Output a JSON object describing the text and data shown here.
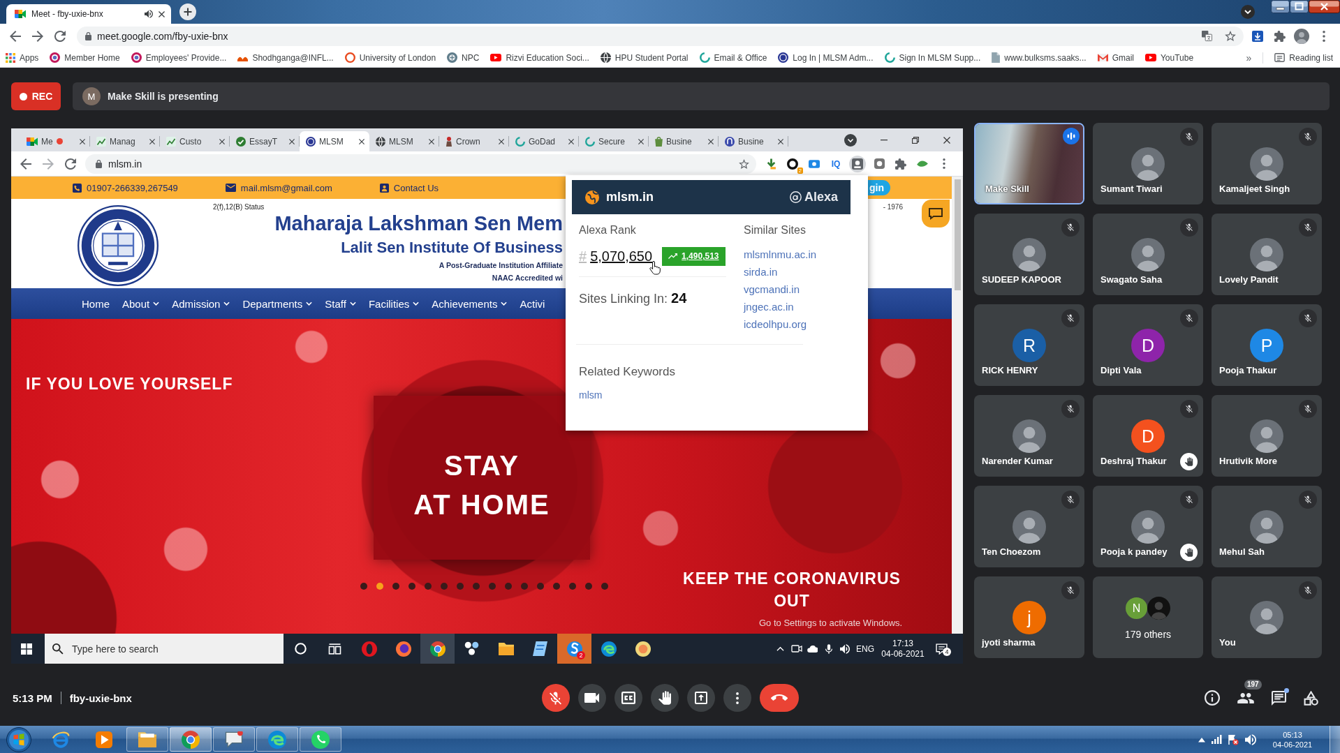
{
  "browser": {
    "tab": {
      "title": "Meet - fby-uxie-bnx",
      "audio": true
    },
    "url": "meet.google.com/fby-uxie-bnx",
    "bookmarks": [
      {
        "label": "Apps",
        "kind": "apps"
      },
      {
        "label": "Member Home",
        "kind": "orb"
      },
      {
        "label": "Employees' Provide...",
        "kind": "orb"
      },
      {
        "label": "Shodhganga@INFL...",
        "kind": "flame"
      },
      {
        "label": "University of London",
        "kind": "ring"
      },
      {
        "label": "NPC",
        "kind": "emblem"
      },
      {
        "label": "Rizvi Education Soci...",
        "kind": "video"
      },
      {
        "label": "HPU Student Portal",
        "kind": "globe"
      },
      {
        "label": "Email & Office",
        "kind": "swirl"
      },
      {
        "label": "Log In | MLSM Adm...",
        "kind": "seal"
      },
      {
        "label": "Sign In MLSM Supp...",
        "kind": "swirl"
      },
      {
        "label": "www.bulksms.saaks...",
        "kind": "page"
      },
      {
        "label": "Gmail",
        "kind": "mail"
      },
      {
        "label": "YouTube",
        "kind": "video"
      }
    ],
    "more": "»",
    "reading_list": "Reading list"
  },
  "meet": {
    "recording": "REC",
    "presenter": {
      "initial": "M",
      "message": "Make Skill is presenting"
    },
    "screen": {
      "tabs": [
        {
          "label": "Me",
          "kind": "meet",
          "recording": true,
          "selected": false
        },
        {
          "label": "Manag",
          "kind": "chart",
          "recording": false,
          "selected": false
        },
        {
          "label": "Custo",
          "kind": "chart",
          "recording": false,
          "selected": false
        },
        {
          "label": "EssayT",
          "kind": "check",
          "recording": false,
          "selected": false
        },
        {
          "label": "MLSM",
          "kind": "seal",
          "recording": false,
          "selected": true
        },
        {
          "label": "MLSM",
          "kind": "globe",
          "recording": false,
          "selected": false
        },
        {
          "label": "Crown",
          "kind": "figure",
          "recording": false,
          "selected": false
        },
        {
          "label": "GoDad",
          "kind": "swirl",
          "recording": false,
          "selected": false
        },
        {
          "label": "Secure",
          "kind": "swirl",
          "recording": false,
          "selected": false
        },
        {
          "label": "Busine",
          "kind": "bag",
          "recording": false,
          "selected": false
        },
        {
          "label": "Busine",
          "kind": "disc",
          "recording": false,
          "selected": false
        }
      ],
      "url": "mlsm.in",
      "extensions": [
        {
          "kind": "pin",
          "selected": false
        },
        {
          "kind": "ring",
          "badge": "2",
          "selected": false
        },
        {
          "kind": "cast",
          "selected": false
        },
        {
          "kind": "label",
          "text": "IQ",
          "selected": false
        },
        {
          "kind": "alexa",
          "selected": true
        },
        {
          "kind": "box",
          "selected": false
        },
        {
          "kind": "puzzle",
          "selected": false
        },
        {
          "kind": "leaf",
          "selected": false
        }
      ],
      "site": {
        "contacts": [
          {
            "kind": "phone",
            "text": "01907-266339,267549"
          },
          {
            "kind": "mail",
            "text": "mail.mlsm@gmail.com"
          },
          {
            "kind": "contact",
            "text": "Contact Us"
          }
        ],
        "login": "gin",
        "status": "2(f),12(B) Status",
        "established": "- 1976",
        "title_lines": [
          "Maharaja Lakshman Sen Mem",
          "Lalit Sen Institute Of Business"
        ],
        "notes": [
          "A Post-Graduate Institution Affiliate",
          "NAAC Accredited wi"
        ],
        "nav": [
          {
            "label": "Home",
            "dropdown": false
          },
          {
            "label": "About",
            "dropdown": true
          },
          {
            "label": "Admission",
            "dropdown": true
          },
          {
            "label": "Departments",
            "dropdown": true
          },
          {
            "label": "Staff",
            "dropdown": true
          },
          {
            "label": "Facilities",
            "dropdown": true
          },
          {
            "label": "Achievements",
            "dropdown": true
          },
          {
            "label": "Activi",
            "dropdown": false
          }
        ],
        "banner": {
          "headline": "IF YOU LOVE YOURSELF",
          "center": [
            "STAY",
            "AT HOME"
          ],
          "footer": [
            "KEEP THE CORONAVIRUS",
            "OUT"
          ],
          "dots": [
            {
              "selected": false
            },
            {
              "selected": true
            },
            {
              "selected": false
            },
            {
              "selected": false
            },
            {
              "selected": false
            },
            {
              "selected": false
            },
            {
              "selected": false
            },
            {
              "selected": false
            },
            {
              "selected": false
            },
            {
              "selected": false
            },
            {
              "selected": false
            },
            {
              "selected": false
            },
            {
              "selected": false
            },
            {
              "selected": false
            },
            {
              "selected": false
            },
            {
              "selected": false
            }
          ]
        }
      },
      "activation_notice": "Go to Settings to activate Windows.",
      "alexa": {
        "domain": "mlsm.in",
        "brand": "Alexa",
        "rank_label": "Alexa Rank",
        "rank_prefix": "#",
        "rank": "5,070,650",
        "change": "1,490,513",
        "linking": "Sites Linking In: **24**",
        "similar_label": "Similar Sites",
        "similar": [
          "mlsmlnmu.ac.in",
          "sirda.in",
          "vgcmandi.in",
          "jngec.ac.in",
          "icdeolhpu.org"
        ],
        "keywords_label": "Related Keywords",
        "keywords": [
          "mlsm"
        ]
      },
      "taskbar": {
        "search": {
          "placeholder": "Type here to search"
        },
        "apps": [
          {
            "kind": "cortana",
            "selected": false,
            "flashing": false
          },
          {
            "kind": "taskview",
            "selected": false,
            "flashing": false
          },
          {
            "kind": "opera",
            "selected": false,
            "flashing": false
          },
          {
            "kind": "firefox",
            "selected": false,
            "flashing": false
          },
          {
            "kind": "chrome",
            "selected": true,
            "flashing": false
          },
          {
            "kind": "dots",
            "selected": false,
            "flashing": false
          },
          {
            "kind": "explorer",
            "selected": false,
            "flashing": false
          },
          {
            "kind": "notepad",
            "selected": false,
            "flashing": false
          },
          {
            "kind": "shield",
            "selected": false,
            "flashing": true,
            "badge": "2"
          },
          {
            "kind": "edge",
            "selected": false,
            "flashing": false
          },
          {
            "kind": "sticky",
            "selected": false,
            "flashing": false
          }
        ],
        "language": "ENG",
        "time": "17:13",
        "date": "04-06-2021",
        "notifications": "4"
      }
    },
    "participants": [
      {
        "name": "Make Skill",
        "kind": "video",
        "muted": false,
        "speaking": true,
        "hand_raised": false
      },
      {
        "name": "Sumant Tiwari",
        "kind": "photo",
        "muted": true,
        "speaking": false,
        "hand_raised": false
      },
      {
        "name": "Kamaljeet Singh",
        "kind": "photo",
        "muted": true,
        "speaking": false,
        "hand_raised": false
      },
      {
        "name": "SUDEEP KAPOOR",
        "kind": "photo",
        "muted": true,
        "speaking": false,
        "hand_raised": false
      },
      {
        "name": "Swagato Saha",
        "kind": "photo",
        "muted": true,
        "speaking": false,
        "hand_raised": false
      },
      {
        "name": "Lovely Pandit",
        "kind": "photo",
        "muted": true,
        "speaking": false,
        "hand_raised": false
      },
      {
        "name": "RICK HENRY",
        "kind": "initial",
        "initial": "R",
        "color": "#1a5fa6",
        "muted": true,
        "speaking": false,
        "hand_raised": false
      },
      {
        "name": "Dipti Vala",
        "kind": "initial",
        "initial": "D",
        "color": "#8e24aa",
        "muted": true,
        "speaking": false,
        "hand_raised": false
      },
      {
        "name": "Pooja Thakur",
        "kind": "initial",
        "initial": "P",
        "color": "#1e88e5",
        "muted": true,
        "speaking": false,
        "hand_raised": false
      },
      {
        "name": "Narender Kumar",
        "kind": "photo",
        "muted": true,
        "speaking": false,
        "hand_raised": false
      },
      {
        "name": "Deshraj Thakur",
        "kind": "initial",
        "initial": "D",
        "color": "#f4511e",
        "muted": true,
        "speaking": false,
        "hand_raised": true
      },
      {
        "name": "Hrutivik More",
        "kind": "photo",
        "muted": true,
        "speaking": false,
        "hand_raised": false
      },
      {
        "name": "Ten Choezom",
        "kind": "photo",
        "muted": true,
        "speaking": false,
        "hand_raised": false
      },
      {
        "name": "Pooja k pandey",
        "kind": "photo",
        "muted": true,
        "speaking": false,
        "hand_raised": true
      },
      {
        "name": "Mehul Sah",
        "kind": "photo",
        "muted": true,
        "speaking": false,
        "hand_raised": false
      },
      {
        "name": "jyoti sharma",
        "kind": "initial",
        "initial": "j",
        "color": "#ef6c00",
        "muted": true,
        "speaking": false,
        "hand_raised": false
      },
      {
        "name": "179 others",
        "kind": "others",
        "initial": "N",
        "color": "#689f38",
        "muted": false,
        "speaking": false,
        "hand_raised": false
      },
      {
        "name": "You",
        "kind": "photo",
        "muted": true,
        "speaking": false,
        "hand_raised": false
      }
    ],
    "clock": "5:13 PM",
    "code": "fby-uxie-bnx",
    "controls": [
      {
        "kind": "mic",
        "off": true
      },
      {
        "kind": "camera",
        "off": false
      },
      {
        "kind": "captions",
        "off": false
      },
      {
        "kind": "hand",
        "off": false
      },
      {
        "kind": "present",
        "off": false
      },
      {
        "kind": "more",
        "off": false
      }
    ],
    "side_controls": [
      {
        "kind": "info",
        "unread": false
      },
      {
        "kind": "people",
        "badge": "197",
        "unread": false
      },
      {
        "kind": "chat",
        "unread": true
      },
      {
        "kind": "activities",
        "unread": false
      }
    ]
  },
  "taskbar": {
    "apps": [
      {
        "kind": "ie",
        "running": false,
        "selected": false
      },
      {
        "kind": "media",
        "running": false,
        "selected": false
      },
      {
        "kind": "explorer",
        "running": true,
        "selected": false
      },
      {
        "kind": "chrome",
        "running": true,
        "selected": true
      },
      {
        "kind": "chat",
        "running": true,
        "selected": false
      },
      {
        "kind": "edge",
        "running": true,
        "selected": false
      },
      {
        "kind": "whatsapp",
        "running": true,
        "selected": false
      }
    ],
    "time": "05:13",
    "date": "04-06-2021"
  }
}
